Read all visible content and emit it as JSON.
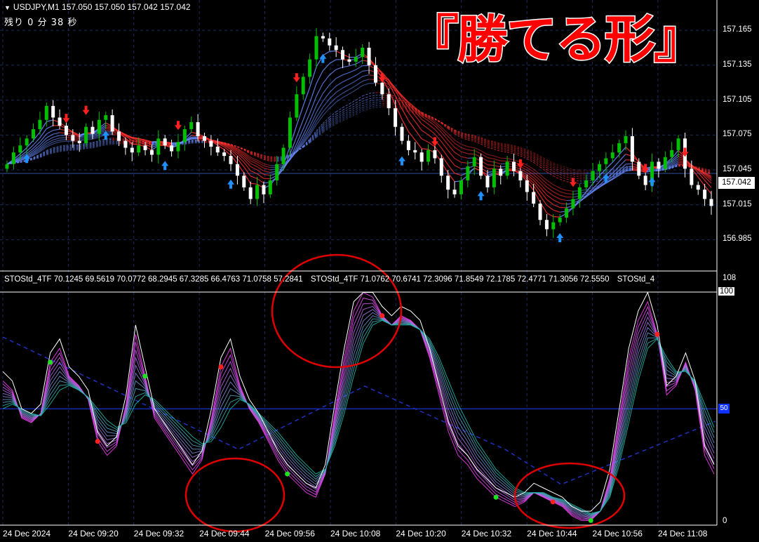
{
  "header": {
    "symbol_line": "USDJPY,M1  157.050 157.050 157.042 157.042",
    "remaining": "残り 0 分 38 秒"
  },
  "banner": {
    "text": "『勝てる形』",
    "color": "#ff0000"
  },
  "colors": {
    "bull_candle": "#00c000",
    "bear_candle": "#ffffff",
    "up_arrow": "#1e90ff",
    "down_arrow": "#ff2020",
    "ribbon_up": "#6a8cff",
    "ribbon_down": "#ff3030",
    "stoch_fast": "#ff40ff",
    "stoch_slow": "#20c0b0",
    "circle": "#e00000",
    "grid": "#1a2a5a",
    "level": "#1e3cff"
  },
  "price_axis": {
    "ticks": [
      "157.165",
      "157.135",
      "157.105",
      "157.075",
      "157.045",
      "157.015",
      "156.985"
    ],
    "current_price": "157.042"
  },
  "indicator": {
    "label_1": "STOStd_4TF 70.1245 69.5619 70.0772 68.2945 67.3285 66.4763 71.0758 57.2841",
    "label_2": "STOStd_4TF 71.0762 70.6741 72.3096 71.8549 72.1785 72.4771 71.3056 72.5550",
    "label_3": "STOStd_4",
    "axis_top": "108",
    "axis_100": "100",
    "level_label": "50",
    "axis_bottom": "0"
  },
  "time_axis": {
    "labels": [
      "24 Dec 2024",
      "24 Dec 09:20",
      "24 Dec 09:32",
      "24 Dec 09:44",
      "24 Dec 09:56",
      "24 Dec 10:08",
      "24 Dec 10:20",
      "24 Dec 10:32",
      "24 Dec 10:44",
      "24 Dec 10:56",
      "24 Dec 11:08"
    ]
  },
  "chart_data": [
    {
      "type": "candlestick",
      "title": "USDJPY,M1",
      "ylim": [
        156.975,
        157.185
      ],
      "series": [
        {
          "name": "close",
          "values": [
            157.05,
            157.06,
            157.066,
            157.072,
            157.08,
            157.088,
            157.1,
            157.09,
            157.083,
            157.075,
            157.07,
            157.068,
            157.082,
            157.076,
            157.088,
            157.092,
            157.078,
            157.07,
            157.064,
            157.06,
            157.066,
            157.062,
            157.058,
            157.072,
            157.066,
            157.061,
            157.069,
            157.08,
            157.086,
            157.074,
            157.07,
            157.065,
            157.06,
            157.057,
            157.05,
            157.04,
            157.03,
            157.02,
            157.032,
            157.024,
            157.036,
            157.05,
            157.064,
            157.09,
            157.11,
            157.125,
            157.14,
            157.16,
            157.158,
            157.152,
            157.148,
            157.14,
            157.138,
            157.142,
            157.15,
            157.135,
            157.12,
            157.11,
            157.098,
            157.082,
            157.07,
            157.062,
            157.06,
            157.052,
            157.062,
            157.055,
            157.04,
            157.028,
            157.024,
            157.036,
            157.048,
            157.056,
            157.04,
            157.03,
            157.046,
            157.04,
            157.052,
            157.044,
            157.036,
            157.026,
            157.016,
            157.002,
            156.994,
            157.0,
            157.004,
            157.012,
            157.02,
            157.03,
            157.036,
            157.044,
            157.05,
            157.055,
            157.06,
            157.068,
            157.074,
            157.052,
            157.04,
            157.032,
            157.052,
            157.046,
            157.056,
            157.062,
            157.072,
            157.046,
            157.032,
            157.028,
            157.02,
            157.014
          ]
        },
        {
          "name": "arrows_up_indices",
          "values": [
            3,
            15,
            24,
            34,
            48,
            60,
            72,
            84,
            91,
            98
          ]
        },
        {
          "name": "arrows_down_indices",
          "values": [
            9,
            12,
            26,
            44,
            57,
            65,
            78,
            86,
            97,
            103
          ]
        }
      ]
    },
    {
      "type": "line",
      "title": "STOStd_4TF",
      "ylim": [
        0,
        108
      ],
      "levels": [
        50,
        100
      ],
      "series": [
        {
          "name": "fast",
          "values": [
            62,
            58,
            46,
            44,
            48,
            70,
            76,
            64,
            60,
            54,
            36,
            30,
            34,
            52,
            82,
            64,
            46,
            40,
            34,
            28,
            22,
            28,
            46,
            68,
            76,
            60,
            50,
            44,
            36,
            28,
            22,
            18,
            14,
            12,
            22,
            48,
            72,
            92,
            100,
            98,
            90,
            86,
            90,
            88,
            84,
            72,
            56,
            40,
            30,
            26,
            20,
            16,
            12,
            10,
            8,
            10,
            14,
            12,
            10,
            8,
            4,
            2,
            2,
            6,
            20,
            46,
            72,
            88,
            96,
            82,
            56,
            60,
            70,
            58,
            30,
            22
          ]
        },
        {
          "name": "slow",
          "values": [
            50,
            52,
            50,
            48,
            47,
            52,
            58,
            60,
            58,
            55,
            50,
            45,
            42,
            44,
            52,
            56,
            54,
            50,
            46,
            42,
            38,
            35,
            36,
            42,
            50,
            54,
            52,
            48,
            44,
            40,
            35,
            30,
            26,
            22,
            24,
            34,
            48,
            64,
            78,
            86,
            88,
            86,
            86,
            86,
            84,
            80,
            72,
            62,
            52,
            44,
            36,
            30,
            24,
            20,
            16,
            14,
            14,
            14,
            12,
            11,
            9,
            7,
            5,
            6,
            12,
            26,
            44,
            62,
            76,
            80,
            72,
            66,
            66,
            62,
            52,
            42
          ]
        },
        {
          "name": "buy_signal_indices",
          "values": [
            5,
            15,
            30,
            52,
            62
          ]
        },
        {
          "name": "sell_signal_indices",
          "values": [
            10,
            23,
            40,
            58,
            69
          ]
        }
      ]
    }
  ]
}
